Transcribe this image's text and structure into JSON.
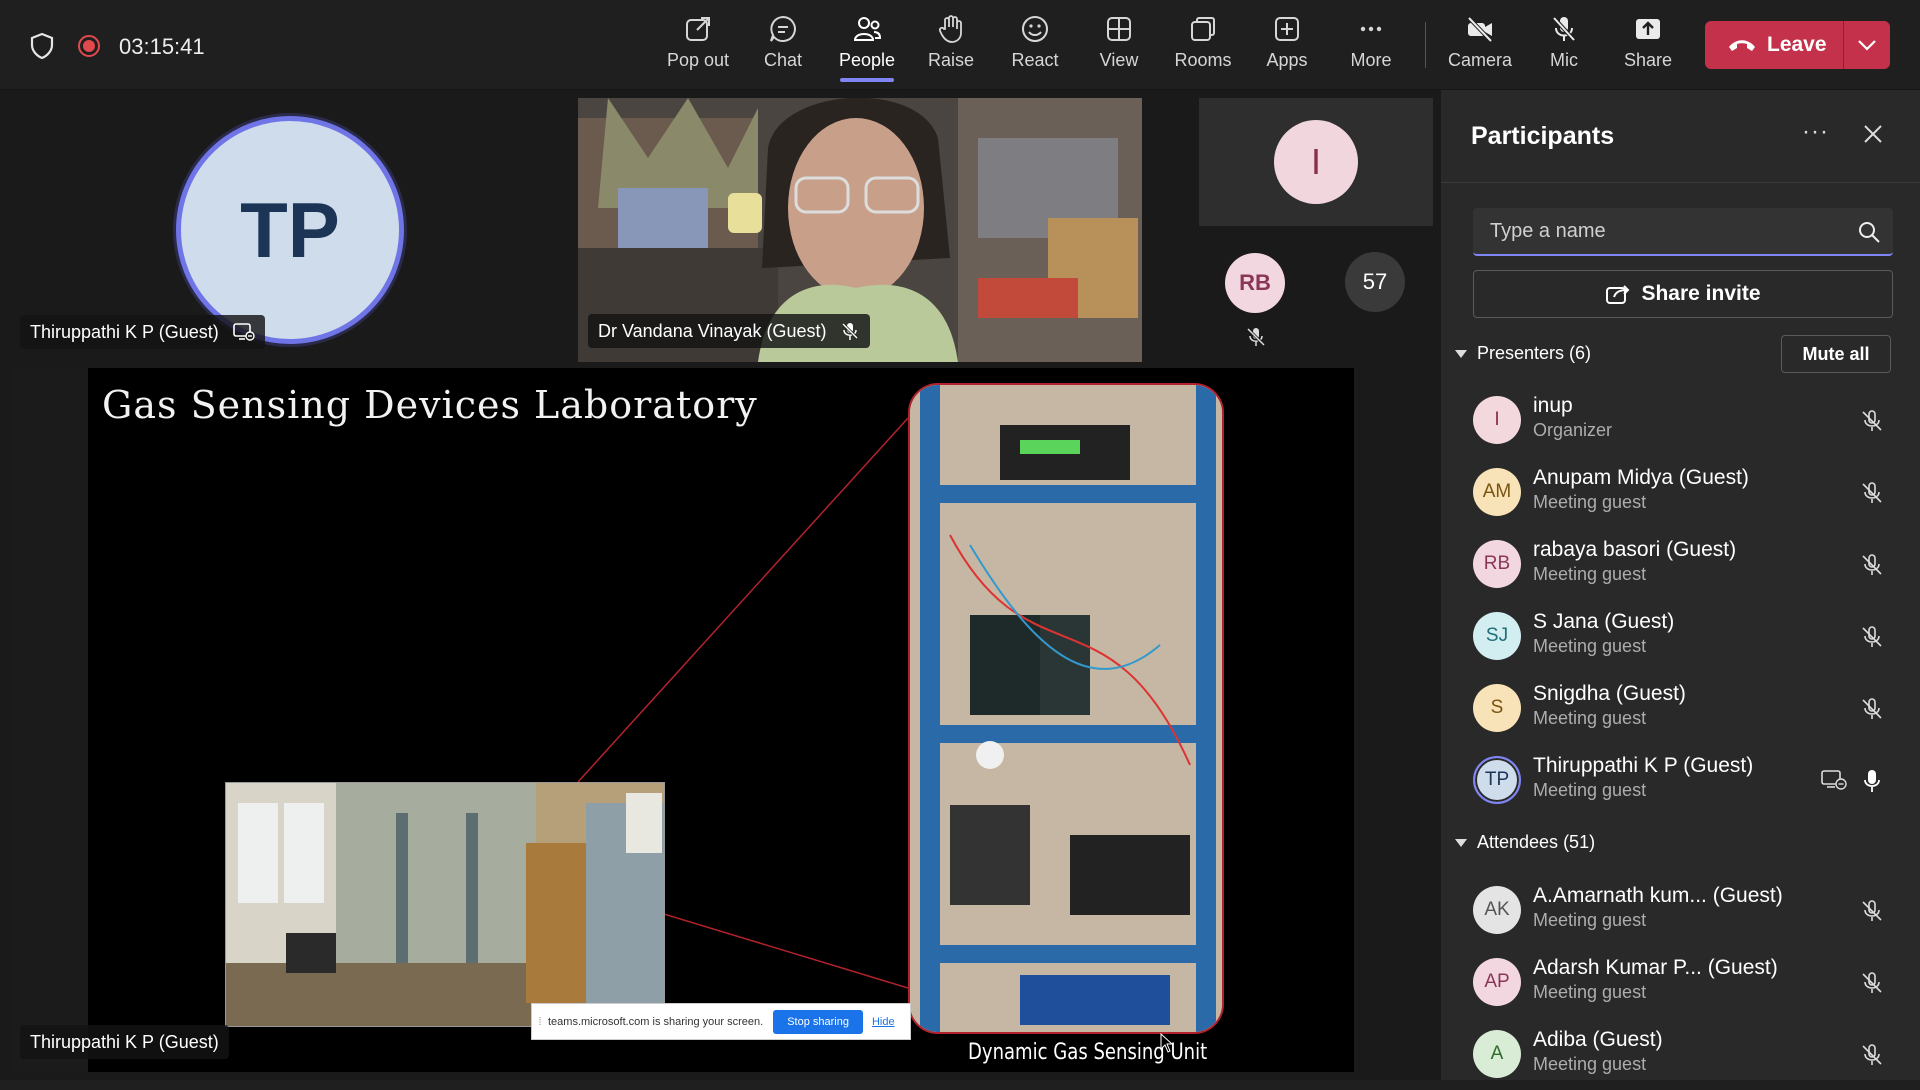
{
  "topbar": {
    "timer": "03:15:41",
    "buttons": [
      {
        "id": "popout",
        "label": "Pop out",
        "icon": "pop-out-icon"
      },
      {
        "id": "chat",
        "label": "Chat",
        "icon": "chat-icon"
      },
      {
        "id": "people",
        "label": "People",
        "icon": "people-icon",
        "active": true
      },
      {
        "id": "raise",
        "label": "Raise",
        "icon": "hand-icon"
      },
      {
        "id": "react",
        "label": "React",
        "icon": "smiley-icon"
      },
      {
        "id": "view",
        "label": "View",
        "icon": "grid-icon"
      },
      {
        "id": "rooms",
        "label": "Rooms",
        "icon": "rooms-icon"
      },
      {
        "id": "apps",
        "label": "Apps",
        "icon": "plus-icon"
      },
      {
        "id": "more",
        "label": "More",
        "icon": "ellipsis-icon"
      },
      {
        "id": "camera",
        "label": "Camera",
        "icon": "camera-off-icon"
      },
      {
        "id": "mic",
        "label": "Mic",
        "icon": "mic-off-icon"
      },
      {
        "id": "share",
        "label": "Share",
        "icon": "share-screen-icon"
      }
    ],
    "leave_label": "Leave",
    "accent": "#7f85f5",
    "leave_color": "#c4314b"
  },
  "stage": {
    "tile_tp": {
      "initials": "TP",
      "name": "Thiruppathi K P (Guest)"
    },
    "tile_video": {
      "name": "Dr Vandana Vinayak (Guest)"
    },
    "tile_i": {
      "initials": "I"
    },
    "tile_rb": {
      "initials": "RB"
    },
    "overflow_count": "57",
    "share_name": "Thiruppathi K P (Guest)",
    "slide": {
      "title": "Gas Sensing Devices Laboratory",
      "caption": "Dynamic Gas Sensing Unit"
    },
    "sharebar": {
      "message": "teams.microsoft.com is sharing your screen.",
      "stop": "Stop sharing",
      "hide": "Hide"
    }
  },
  "panel": {
    "title": "Participants",
    "search_placeholder": "Type a name",
    "share_invite": "Share invite",
    "presenters_label": "Presenters (6)",
    "mute_all": "Mute all",
    "attendees_label": "Attendees (51)",
    "presenters": [
      {
        "initials": "I",
        "name": "inup",
        "role": "Organizer",
        "bg": "#f3d9de",
        "fg": "#8a2f4a"
      },
      {
        "initials": "AM",
        "name": "Anupam Midya (Guest)",
        "role": "Meeting guest",
        "bg": "#f8e2b8",
        "fg": "#7a5410"
      },
      {
        "initials": "RB",
        "name": "rabaya basori (Guest)",
        "role": "Meeting guest",
        "bg": "#f3d7e0",
        "fg": "#8a3757"
      },
      {
        "initials": "SJ",
        "name": "S Jana (Guest)",
        "role": "Meeting guest",
        "bg": "#d3eef0",
        "fg": "#1f6e78"
      },
      {
        "initials": "S",
        "name": "Snigdha (Guest)",
        "role": "Meeting guest",
        "bg": "#f8e2b8",
        "fg": "#7a5410"
      },
      {
        "initials": "TP",
        "name": "Thiruppathi K P (Guest)",
        "role": "Meeting guest",
        "bg": "#cfdcec",
        "fg": "#1c3557",
        "sharing": true
      }
    ],
    "attendees": [
      {
        "initials": "AK",
        "name": "A.Amarnath kum... (Guest)",
        "role": "Meeting guest",
        "bg": "#e4e4e4",
        "fg": "#555555"
      },
      {
        "initials": "AP",
        "name": "Adarsh Kumar P...  (Guest)",
        "role": "Meeting guest",
        "bg": "#f3d7e0",
        "fg": "#8a3757"
      },
      {
        "initials": "A",
        "name": "Adiba (Guest)",
        "role": "Meeting guest",
        "bg": "#d8ecd6",
        "fg": "#2e6b2a"
      }
    ]
  }
}
